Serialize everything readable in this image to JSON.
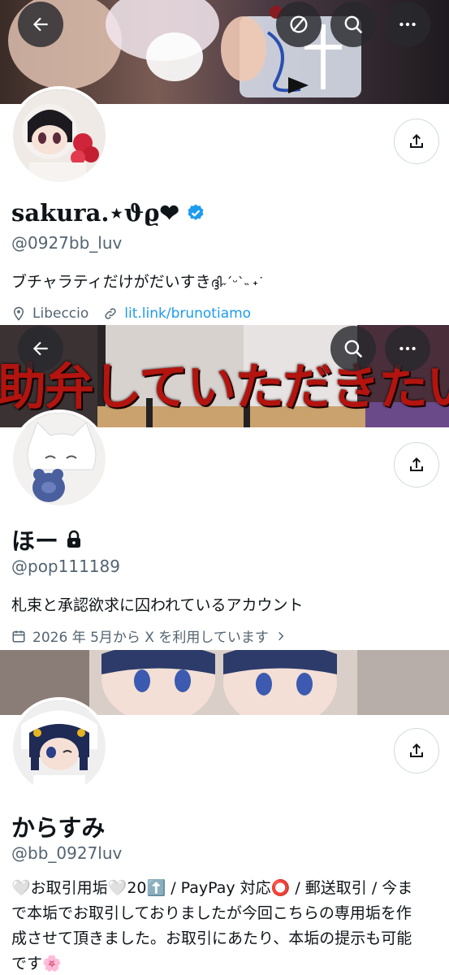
{
  "profiles": [
    {
      "display_name": "sakura.⋆ϑϱ❤",
      "verified": true,
      "handle": "@0927bb_luv",
      "bio": "ブチャラティだけがだいすき",
      "bio_kaomoji": "ദ്ദി˶ˊᵕˋ˵ ˖˙",
      "location": "Libeccio",
      "link": "lit.link/brunotiamo"
    },
    {
      "display_name": "ほー",
      "locked": true,
      "handle": "@pop111189",
      "bio": "札束と承認欲求に囚われているアカウント",
      "joined": "2026 年 5月から X を利用しています",
      "banner_text": "助弁していただきたい"
    },
    {
      "display_name": "からすみ",
      "handle": "@bb_0927luv",
      "bio_line1": "🤍お取引用垢🤍20⬆️ / PayPay 対応⭕️ / 郵送取引 / 今ま",
      "bio_line2": "で本垢でお取引しておりましたが今回こちらの専用垢を作",
      "bio_line3": "成させて頂きました。お取引にあたり、本垢の提示も可能",
      "bio_line4": "です🌸"
    }
  ],
  "colors": {
    "accent": "#1d9bf0",
    "secondary_text": "#536471",
    "verified": "#1d9bf0",
    "banner_red": "#b3140f"
  },
  "icons": [
    "back-arrow-icon",
    "no-symbol-icon",
    "search-icon",
    "more-icon",
    "share-icon",
    "location-icon",
    "link-icon",
    "calendar-icon",
    "lock-icon",
    "verified-badge-icon",
    "chevron-right-icon"
  ]
}
